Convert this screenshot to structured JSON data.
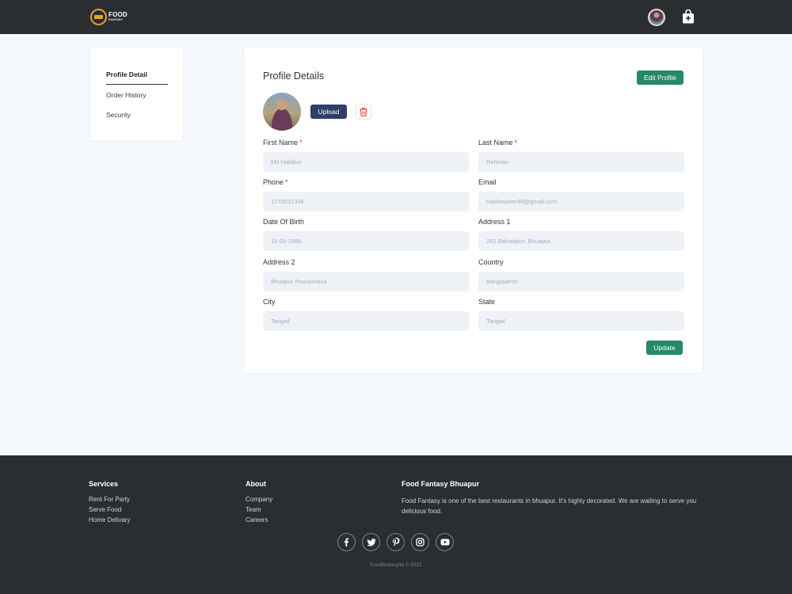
{
  "header": {
    "logo": {
      "line1": "FOOD",
      "line2": "FANTASY"
    },
    "icons": {
      "avatar": "user-avatar",
      "cart": "shopping-bag-icon"
    }
  },
  "sidebar": {
    "items": [
      {
        "label": "Profile Detail",
        "active": true
      },
      {
        "label": "Order History",
        "active": false
      },
      {
        "label": "Security",
        "active": false
      }
    ]
  },
  "profile": {
    "title": "Profile Details",
    "edit_label": "Edit Profile",
    "upload_label": "Upload",
    "update_label": "Update",
    "required_mark": "*",
    "fields": {
      "first_name": {
        "label": "First Name",
        "value": "Md Habibur"
      },
      "last_name": {
        "label": "Last Name",
        "value": "Rahman"
      },
      "phone": {
        "label": "Phone",
        "value": "1770531336"
      },
      "email": {
        "label": "Email",
        "value": "habibtusher98@gmail.com"
      },
      "dob": {
        "label": "Date Of Birth",
        "value": "15-03-1998"
      },
      "address1": {
        "label": "Address 1",
        "value": "262 Bahadipur, Bhuapur."
      },
      "address2": {
        "label": "Address 2",
        "value": "Bhuapur Pourashava"
      },
      "country": {
        "label": "Country",
        "value": "Bangladesh"
      },
      "city": {
        "label": "City",
        "value": "Tangail"
      },
      "state": {
        "label": "State",
        "value": "Tangail"
      }
    }
  },
  "footer": {
    "services": {
      "title": "Services",
      "links": [
        "Rent For Party",
        "Serve Food",
        "Home Delivary"
      ]
    },
    "about": {
      "title": "About",
      "links": [
        "Company",
        "Team",
        "Careers"
      ]
    },
    "brand": {
      "title": "Food Fantasy Bhuapur",
      "text": "Food Fantasy is one of the best restaurants in bhuapur. It's highly decorated. We are waiting to serve you delicious food."
    },
    "social": [
      "facebook-icon",
      "twitter-icon",
      "pinterest-icon",
      "instagram-icon",
      "youtube-icon"
    ],
    "copyright": "Foodfantasyltd © 2021"
  },
  "colors": {
    "accent_green": "#27886a",
    "upload_navy": "#2e3f68",
    "dark_bar": "#2b2e31",
    "required_red": "#e0302f"
  }
}
